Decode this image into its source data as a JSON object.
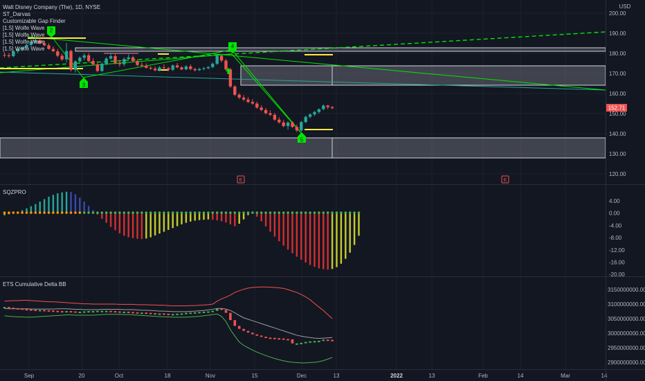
{
  "header": {
    "title": "Walt Disney Company (The), 1D, NYSE",
    "indicators": [
      "ST_Darvas",
      "Customizable Gap Finder",
      "[1.5] Wolfe Wave",
      "[1.5] Wolfe Wave",
      "[1.5] Wolfe Wave",
      "[1.5] Wolfe Wave"
    ],
    "currency": "USD"
  },
  "colors": {
    "background": "#131722",
    "up": "#26a69a",
    "down": "#ef5350",
    "wolfe": "#00e600",
    "yellow": "#ffeb3b",
    "box": "#787b86"
  },
  "price_axis": {
    "labels": [
      "200.00",
      "190.00",
      "180.00",
      "170.00",
      "160.00",
      "150.00",
      "140.00",
      "130.00",
      "120.00"
    ],
    "current_price": "152.71"
  },
  "sqz_axis": {
    "title": "SQZPRO",
    "labels": [
      "4.00",
      "0.00",
      "-4.00",
      "-8.00",
      "-12.00",
      "-16.00",
      "-20.00"
    ]
  },
  "delta_axis": {
    "title": "ETS Cumulative Delta BB",
    "labels": [
      "3150000000.00",
      "3100000000.00",
      "3050000000.00",
      "3000000000.00",
      "2950000000.00",
      "2900000000.00"
    ]
  },
  "time_axis": {
    "labels": [
      "Sep",
      "20",
      "Oct",
      "18",
      "Nov",
      "15",
      "Dec",
      "13",
      "2022",
      "13",
      "Feb",
      "14",
      "Mar",
      "14"
    ]
  },
  "wolfe_labels": [
    "2",
    "3",
    "4",
    "5"
  ],
  "earnings_markers": [
    "E",
    "E"
  ],
  "chart_data": {
    "type": "candlestick",
    "ylim": [
      115,
      203
    ],
    "candles": [
      [
        179.2,
        180.5,
        178.0,
        179.0
      ],
      [
        179.0,
        180.2,
        177.8,
        178.6
      ],
      [
        178.6,
        181.5,
        178.0,
        181.0
      ],
      [
        181.0,
        182.8,
        180.2,
        182.0
      ],
      [
        182.0,
        183.5,
        181.2,
        183.0
      ],
      [
        183.0,
        184.8,
        182.1,
        184.2
      ],
      [
        184.2,
        186.6,
        183.5,
        185.8
      ],
      [
        185.8,
        187.8,
        185.0,
        186.5
      ],
      [
        186.5,
        187.5,
        184.5,
        185.0
      ],
      [
        185.0,
        186.2,
        183.5,
        184.0
      ],
      [
        184.0,
        185.0,
        181.8,
        182.2
      ],
      [
        182.2,
        183.5,
        180.8,
        181.0
      ],
      [
        181.0,
        182.2,
        178.0,
        178.8
      ],
      [
        178.8,
        179.8,
        176.2,
        177.0
      ],
      [
        177.0,
        185.2,
        175.5,
        181.2
      ],
      [
        181.2,
        181.8,
        171.0,
        171.8
      ],
      [
        171.8,
        176.5,
        170.5,
        176.0
      ],
      [
        176.0,
        178.5,
        175.0,
        177.8
      ],
      [
        177.8,
        180.0,
        176.5,
        179.0
      ],
      [
        179.0,
        180.2,
        175.5,
        176.2
      ],
      [
        176.2,
        177.6,
        174.0,
        174.5
      ],
      [
        174.5,
        175.2,
        170.5,
        171.2
      ],
      [
        171.2,
        175.5,
        170.8,
        174.8
      ],
      [
        174.8,
        178.2,
        174.0,
        177.4
      ],
      [
        177.4,
        180.0,
        176.8,
        178.6
      ],
      [
        178.6,
        180.2,
        174.5,
        175.2
      ],
      [
        175.2,
        176.6,
        173.4,
        174.6
      ],
      [
        174.6,
        178.0,
        173.6,
        177.2
      ],
      [
        177.2,
        179.5,
        176.5,
        178.0
      ],
      [
        178.0,
        178.8,
        175.5,
        176.2
      ],
      [
        176.2,
        177.0,
        173.5,
        174.2
      ],
      [
        174.2,
        175.5,
        173.0,
        173.8
      ],
      [
        173.8,
        175.0,
        172.4,
        172.8
      ],
      [
        172.8,
        173.6,
        171.8,
        172.4
      ],
      [
        172.4,
        173.5,
        171.0,
        171.6
      ],
      [
        171.6,
        173.6,
        171.0,
        173.0
      ],
      [
        173.0,
        174.5,
        172.2,
        172.6
      ],
      [
        172.6,
        173.2,
        171.2,
        171.8
      ],
      [
        171.8,
        174.5,
        171.2,
        174.0
      ],
      [
        174.0,
        175.2,
        172.6,
        173.0
      ],
      [
        173.0,
        173.6,
        171.6,
        172.0
      ],
      [
        172.0,
        174.2,
        171.6,
        173.5
      ],
      [
        173.5,
        174.5,
        171.6,
        172.2
      ],
      [
        172.2,
        172.8,
        171.0,
        171.6
      ],
      [
        171.6,
        172.8,
        171.2,
        172.2
      ],
      [
        172.2,
        173.2,
        171.6,
        172.6
      ],
      [
        172.6,
        173.6,
        172.0,
        173.2
      ],
      [
        173.2,
        175.5,
        172.6,
        174.8
      ],
      [
        174.8,
        179.5,
        174.2,
        178.8
      ],
      [
        178.8,
        179.2,
        175.5,
        176.4
      ],
      [
        176.4,
        177.2,
        171.5,
        172.0
      ],
      [
        172.0,
        172.8,
        162.8,
        163.5
      ],
      [
        163.5,
        164.2,
        158.8,
        159.4
      ],
      [
        159.4,
        160.2,
        157.2,
        158.0
      ],
      [
        158.0,
        159.2,
        156.2,
        157.0
      ],
      [
        157.0,
        158.2,
        155.2,
        155.8
      ],
      [
        155.8,
        157.2,
        154.4,
        155.0
      ],
      [
        155.0,
        156.0,
        152.4,
        153.0
      ],
      [
        153.0,
        154.2,
        151.2,
        151.8
      ],
      [
        151.8,
        152.8,
        149.6,
        150.2
      ],
      [
        150.2,
        151.6,
        148.8,
        149.4
      ],
      [
        149.4,
        150.4,
        146.4,
        147.0
      ],
      [
        147.0,
        148.2,
        145.0,
        145.6
      ],
      [
        145.6,
        146.8,
        143.2,
        143.8
      ],
      [
        143.8,
        146.2,
        142.0,
        145.6
      ],
      [
        145.6,
        146.2,
        142.8,
        143.4
      ],
      [
        143.4,
        144.6,
        140.8,
        141.6
      ],
      [
        141.6,
        146.4,
        141.0,
        145.8
      ],
      [
        145.8,
        149.0,
        145.2,
        148.4
      ],
      [
        148.4,
        150.2,
        147.6,
        149.6
      ],
      [
        149.6,
        151.4,
        148.8,
        150.8
      ],
      [
        150.8,
        152.6,
        150.0,
        152.2
      ],
      [
        152.2,
        154.6,
        151.6,
        154.0
      ],
      [
        154.0,
        154.4,
        152.2,
        153.2
      ],
      [
        153.2,
        153.8,
        152.2,
        152.71
      ]
    ]
  },
  "sqz_data": {
    "momentum": [
      -0.8,
      -0.5,
      -0.2,
      0.3,
      0.8,
      1.4,
      2.1,
      2.8,
      3.6,
      4.4,
      5.2,
      5.8,
      6.3,
      6.6,
      6.8,
      6.7,
      6.0,
      4.9,
      3.6,
      2.2,
      0.8,
      -0.6,
      -2.0,
      -3.3,
      -4.6,
      -5.7,
      -6.7,
      -7.5,
      -8.0,
      -8.3,
      -8.5,
      -8.6,
      -8.4,
      -8.0,
      -7.4,
      -6.8,
      -6.2,
      -5.6,
      -5.0,
      -4.4,
      -3.8,
      -3.3,
      -2.9,
      -2.6,
      -2.4,
      -2.3,
      -2.2,
      -2.3,
      -2.5,
      -2.8,
      -3.2,
      -3.8,
      -4.4,
      -3.6,
      -2.2,
      -0.8,
      -0.3,
      -1.3,
      -2.8,
      -4.5,
      -6.2,
      -7.8,
      -9.3,
      -10.7,
      -12.0,
      -13.2,
      -14.3,
      -15.3,
      -16.2,
      -17.0,
      -17.6,
      -18.1,
      -18.4,
      -18.5,
      -18.3,
      -17.7,
      -16.6,
      -15.0,
      -13.0,
      -10.5,
      -7.5
    ]
  },
  "delta_data": {
    "values": [
      3090,
      3088,
      3086,
      3085,
      3083,
      3082,
      3081,
      3080,
      3080,
      3079,
      3078,
      3077,
      3076,
      3075,
      3076,
      3075,
      3074,
      3074,
      3075,
      3076,
      3076,
      3077,
      3077,
      3077,
      3076,
      3075,
      3074,
      3074,
      3073,
      3072,
      3071,
      3071,
      3070,
      3069,
      3068,
      3068,
      3067,
      3066,
      3066,
      3067,
      3068,
      3070,
      3071,
      3072,
      3073,
      3074,
      3075,
      3077,
      3085,
      3080,
      3070,
      3045,
      3025,
      3015,
      3008,
      3002,
      2996,
      2992,
      2988,
      2985,
      2984,
      2983,
      2982,
      2980,
      2979,
      2965,
      2965,
      2967,
      2970,
      2972,
      2973,
      2974,
      2978,
      2977,
      2976
    ],
    "upper_band": [
      3110,
      3111,
      3112,
      3112,
      3113,
      3113,
      3112,
      3111,
      3110,
      3109,
      3108,
      3108,
      3107,
      3106,
      3105,
      3104,
      3103,
      3102,
      3101,
      3101,
      3100,
      3100,
      3100,
      3100,
      3100,
      3100,
      3099,
      3099,
      3099,
      3099,
      3098,
      3098,
      3098,
      3097,
      3097,
      3096,
      3096,
      3095,
      3094,
      3094,
      3094,
      3094,
      3095,
      3095,
      3096,
      3097,
      3098,
      3100,
      3110,
      3118,
      3124,
      3131,
      3140,
      3146,
      3151,
      3155,
      3157,
      3158,
      3159,
      3159,
      3158,
      3157,
      3156,
      3154,
      3150,
      3145,
      3140,
      3133,
      3125,
      3115,
      3102,
      3090,
      3078,
      3064,
      3050
    ],
    "lower_band": [
      3060,
      3058,
      3057,
      3056,
      3056,
      3055,
      3055,
      3056,
      3057,
      3058,
      3059,
      3060,
      3061,
      3062,
      3063,
      3063,
      3062,
      3062,
      3062,
      3062,
      3062,
      3063,
      3064,
      3065,
      3065,
      3065,
      3065,
      3064,
      3064,
      3063,
      3062,
      3061,
      3060,
      3059,
      3058,
      3057,
      3056,
      3056,
      3055,
      3055,
      3055,
      3055,
      3056,
      3057,
      3058,
      3060,
      3062,
      3064,
      3066,
      3058,
      3040,
      3012,
      2990,
      2970,
      2958,
      2950,
      2942,
      2935,
      2929,
      2923,
      2918,
      2913,
      2909,
      2905,
      2902,
      2900,
      2899,
      2898,
      2898,
      2899,
      2900,
      2902,
      2906,
      2911,
      2917
    ],
    "basis": [
      3085,
      3084,
      3084,
      3084,
      3084,
      3084,
      3083,
      3083,
      3083,
      3083,
      3083,
      3083,
      3084,
      3084,
      3084,
      3083,
      3082,
      3082,
      3081,
      3081,
      3081,
      3081,
      3082,
      3082,
      3082,
      3082,
      3082,
      3081,
      3081,
      3081,
      3080,
      3079,
      3079,
      3078,
      3077,
      3076,
      3076,
      3075,
      3074,
      3074,
      3074,
      3074,
      3075,
      3076,
      3077,
      3078,
      3080,
      3082,
      3085,
      3085,
      3083,
      3078,
      3070,
      3061,
      3053,
      3048,
      3043,
      3038,
      3033,
      3028,
      3023,
      3018,
      3013,
      3008,
      3003,
      2998,
      2993,
      2990,
      2987,
      2985,
      2983,
      2982,
      2983,
      2984,
      2985
    ]
  }
}
